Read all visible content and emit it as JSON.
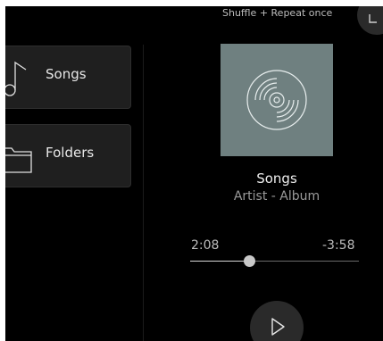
{
  "playback": {
    "mode_label": "Shuffle + Repeat once"
  },
  "nav": {
    "items": [
      {
        "label": "Songs",
        "icon": "music-note-icon"
      },
      {
        "label": "Folders",
        "icon": "folder-icon"
      }
    ]
  },
  "now_playing": {
    "title": "Songs",
    "subtitle": "Artist - Album",
    "elapsed": "2:08",
    "remaining": "-3:58",
    "progress": 0.35,
    "art_icon": "vinyl-record-icon"
  },
  "colors": {
    "background": "#000000",
    "card": "#1f1f1f",
    "album_art": "#6f8080",
    "button": "#2a2a2a"
  }
}
